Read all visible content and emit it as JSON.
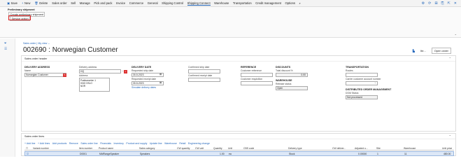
{
  "actionbar": {
    "save": "Save",
    "new": "New",
    "delete": "Delete",
    "menus": [
      "Sales order",
      "Sell",
      "Manage",
      "Pick and pack",
      "Invoice",
      "Commerce",
      "General",
      "Shipping Control",
      "Shipping Connect",
      "Warehouse",
      "Transportation",
      "Credit management",
      "Options"
    ],
    "active_menu": "Shipping Connect"
  },
  "ribbon": {
    "group_title": "Preliminary shipment",
    "create_button": "Create preliminary shipment",
    "service_button": "Service option"
  },
  "breadcrumb": {
    "sales_order": "Sales order",
    "separator": "|",
    "view": "My view"
  },
  "page_title": "002690 : Norwegian Customer",
  "header_right": {
    "more": "Ite...",
    "open_order": "Open order"
  },
  "header_panel": {
    "title": "Sales order header",
    "delivery_address": {
      "section": "DELIVERY ADDRESS",
      "name_label": "Name",
      "name_value": "Norwegian Customer",
      "delivery_address_label": "Delivery address",
      "delivery_address_value": "HQ",
      "address_label": "Address",
      "address_lines": [
        "Postbanveien 1",
        "0015 OSLO",
        "NOR"
      ]
    },
    "delivery_date": {
      "section": "DELIVERY DATE",
      "req_ship_label": "Requested ship date",
      "req_ship_value": "30-5-2023",
      "req_receipt_label": "Requested receipt date",
      "req_receipt_value": "30-5-2023",
      "simulate_link": "Simulate delivery dates",
      "confirmed_ship_label": "Confirmed ship date",
      "confirmed_receipt_label": "Confirmed receipt date"
    },
    "reference": {
      "section": "REFERENCE",
      "customer_ref_label": "Customer reference",
      "customer_req_label": "Customer requisition"
    },
    "discounts": {
      "section": "DISCOUNTS",
      "total_discount_label": "Total discount %",
      "total_discount_value": "0.00"
    },
    "warehouse": {
      "section": "WAREHOUSE",
      "release_status_label": "Release status",
      "release_status_value": "Open"
    },
    "transportation": {
      "section": "TRANSPORTATION",
      "routes_label": "Routes",
      "carrier_label": "Carrier customer account number"
    },
    "dom": {
      "section": "DISTRIBUTED ORDER MANAGEMENT",
      "status_label": "DOM Status",
      "status_value": "Not processed"
    }
  },
  "lines_panel": {
    "title": "Sales order lines",
    "toolbar": [
      "+ Add line",
      "+ Add lines",
      "Add products",
      "Remove",
      "Sales order line",
      "Financials",
      "Inventory",
      "Product and supply",
      "Update line",
      "Warehouse",
      "Retail",
      "Engineering change"
    ],
    "columns": [
      "Variant number",
      "Item number",
      "Product name",
      "Sales category",
      "CW quantity",
      "CW unit",
      "Quantity",
      "Unit",
      "CBS code",
      "Delivery type",
      "CW deliver...",
      "Adjusted u...",
      "Site",
      "Warehouse",
      "Unit price"
    ],
    "row": {
      "item_number": "D0001",
      "product_name": "MidRangeSpeaker",
      "sales_category": "Speakers",
      "quantity": "1.00",
      "unit": "ea",
      "delivery_type": "Stock",
      "adjusted": "0.00000",
      "site": "1",
      "warehouse": "11",
      "unit_price": "480.00"
    }
  },
  "colors": {
    "accent": "#2266bb",
    "highlight_red": "#dd2222"
  }
}
